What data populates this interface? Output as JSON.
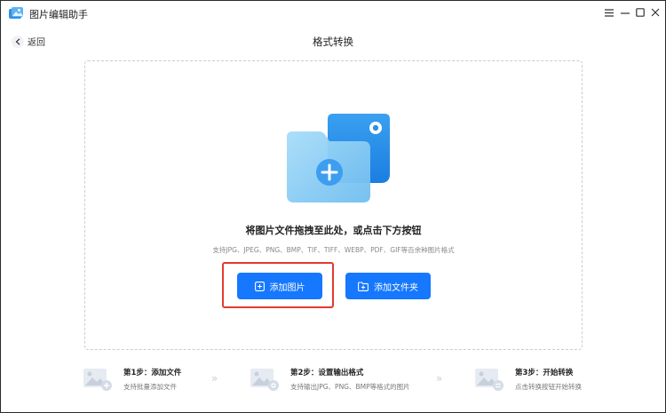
{
  "app": {
    "title": "图片编辑助手"
  },
  "nav": {
    "back_label": "返回",
    "page_title": "格式转换"
  },
  "dropzone": {
    "title": "将图片文件拖拽至此处，或点击下方按钮",
    "formats": "支持JPG、JPEG、PNG、BMP、TIF、TIFF、WEBP、PDF、GIF等百余种图片格式",
    "add_image_label": "添加图片",
    "add_folder_label": "添加文件夹"
  },
  "steps": [
    {
      "title": "第1步：添加文件",
      "desc": "支持批量添加文件",
      "icon": "image-add-icon"
    },
    {
      "title": "第2步：设置输出格式",
      "desc": "支持输出JPG、PNG、BMP等格式的图片",
      "icon": "image-settings-icon"
    },
    {
      "title": "第3步：开始转换",
      "desc": "点击转换按钮开始转换",
      "icon": "image-convert-icon"
    }
  ],
  "colors": {
    "accent": "#1677ff",
    "highlight": "#e23b2e",
    "folder_back": "#2f8fe6",
    "folder_front": "#8ed0f5"
  },
  "icons": {
    "window_controls": [
      "menu-icon",
      "minimize-icon",
      "maximize-icon",
      "close-icon"
    ],
    "back": "chevron-left-icon",
    "step_separator": "double-chevron-right-icon"
  }
}
